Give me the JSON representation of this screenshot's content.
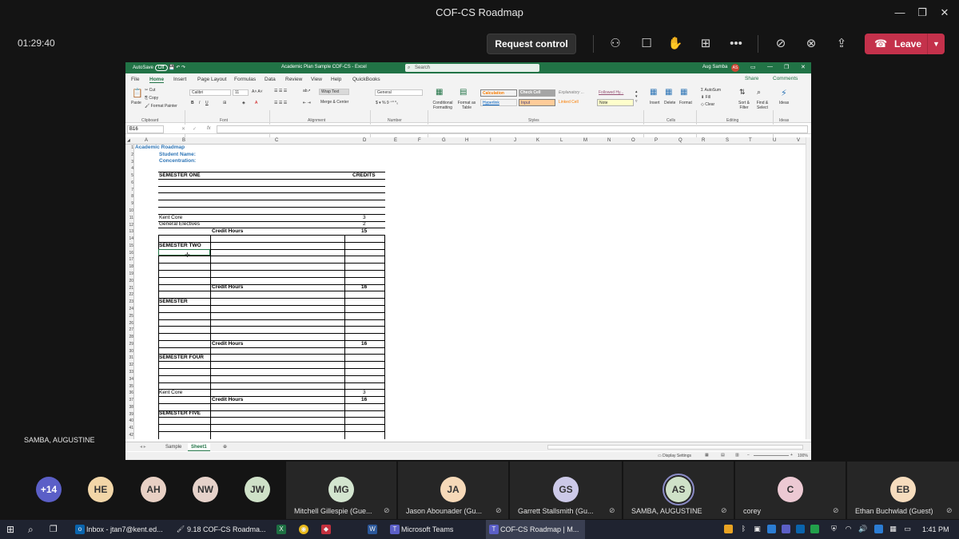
{
  "window": {
    "title": "COF-CS Roadmap"
  },
  "toolbar": {
    "timer": "01:29:40",
    "request_control": "Request control",
    "leave": "Leave"
  },
  "excel": {
    "autosave": "AutoSave",
    "autosave_state": "Off",
    "title": "Academic Plan Sample COF-CS  -  Excel",
    "search_placeholder": "Search",
    "user": "Aug Samba",
    "user_initials": "AS",
    "menu": [
      "File",
      "Home",
      "Insert",
      "Page Layout",
      "Formulas",
      "Data",
      "Review",
      "View",
      "Help",
      "QuickBooks"
    ],
    "share": "Share",
    "comments": "Comments",
    "ribbon": {
      "clipboard": {
        "paste": "Paste",
        "cut": "Cut",
        "copy": "Copy",
        "format_painter": "Format Painter",
        "label": "Clipboard"
      },
      "font": {
        "name": "Calibri",
        "size": "11",
        "label": "Font"
      },
      "alignment": {
        "wrap": "Wrap Text",
        "merge": "Merge & Center",
        "label": "Alignment"
      },
      "number": {
        "format": "General",
        "label": "Number"
      },
      "styles": {
        "conditional": "Conditional Formatting",
        "format_table": "Format as Table",
        "cells": [
          "Calculation",
          "Check Cell",
          "Explanatory ...",
          "Followed Hy...",
          "Hyperlink",
          "Input",
          "Linked Cell",
          "Note"
        ],
        "label": "Styles"
      },
      "cells": {
        "insert": "Insert",
        "delete": "Delete",
        "format": "Format",
        "label": "Cells"
      },
      "editing": {
        "autosum": "AutoSum",
        "fill": "Fill",
        "clear": "Clear",
        "sort": "Sort & Filter",
        "find": "Find & Select",
        "label": "Editing"
      },
      "ideas": {
        "btn": "Ideas",
        "label": "Ideas"
      }
    },
    "name_box": "B16",
    "formula_fx": "fx",
    "columns": [
      "A",
      "B",
      "C",
      "D",
      "E",
      "F",
      "G",
      "H",
      "I",
      "J",
      "K",
      "L",
      "M",
      "N",
      "O",
      "P",
      "Q",
      "R",
      "S",
      "T",
      "U",
      "V"
    ],
    "rows": [
      "1",
      "2",
      "3",
      "4",
      "5",
      "6",
      "7",
      "8",
      "9",
      "10",
      "11",
      "12",
      "13",
      "14",
      "15",
      "16",
      "17",
      "18",
      "19",
      "20",
      "21",
      "22",
      "23",
      "24",
      "25",
      "26",
      "27",
      "28",
      "29",
      "30",
      "31",
      "32",
      "33",
      "34",
      "35",
      "36",
      "37",
      "38",
      "39",
      "40",
      "41",
      "42"
    ],
    "cells": {
      "a1": "Academic Roadmap",
      "b2": "Student Name:",
      "b3": "Concentration:",
      "b5": "SEMESTER ONE",
      "d5": "CREDITS",
      "b11": "Kent Core",
      "d11": "3",
      "b12": "General Electives",
      "d12": "2",
      "c13": "Credit Hours",
      "d13": "15",
      "b15": "SEMESTER TWO",
      "c21": "Credit Hours",
      "d21": "16",
      "b23": "SEMESTER",
      "c29": "Credit Hours",
      "d29": "16",
      "b31": "SEMESTER FOUR",
      "b36": "Kent Core",
      "d36": "3",
      "c37": "Credit Hours",
      "d37": "16",
      "b39": "SEMESTER FIVE"
    },
    "sheets": [
      "Sample",
      "Sheet1"
    ],
    "active_sheet": "Sheet1",
    "status": {
      "display_settings": "Display Settings",
      "zoom": "100%"
    }
  },
  "presenter_name": "SAMBA, AUGUSTINE",
  "participants": [
    {
      "initials": "+14",
      "name": "",
      "color": "#5b5fc7"
    },
    {
      "initials": "HE",
      "name": "",
      "color": "#f2d6a8"
    },
    {
      "initials": "AH",
      "name": "",
      "color": "#e8d0c4"
    },
    {
      "initials": "NW",
      "name": "",
      "color": "#e6d2ca"
    },
    {
      "initials": "JW",
      "name": "",
      "color": "#cfe1c8"
    },
    {
      "initials": "MG",
      "name": "Mitchell Gillespie (Gue...",
      "color": "#d3e5cf"
    },
    {
      "initials": "JA",
      "name": "Jason Abounader (Gu...",
      "color": "#f6d9b8"
    },
    {
      "initials": "GS",
      "name": "Garrett Stallsmith (Gu...",
      "color": "#ccc9e8"
    },
    {
      "initials": "AS",
      "name": "SAMBA, AUGUSTINE",
      "color": "#cfe1c8"
    },
    {
      "initials": "C",
      "name": "corey",
      "color": "#ecc9d3"
    },
    {
      "initials": "EB",
      "name": "Ethan Buchwlad (Guest)",
      "color": "#f6dcbd"
    }
  ],
  "taskbar": {
    "apps": [
      "Inbox - jtan7@kent.ed...",
      "9.18 COF-CS Roadma...",
      "Microsoft Teams",
      "COF-CS Roadmap | M..."
    ],
    "time": "1:41 PM"
  }
}
